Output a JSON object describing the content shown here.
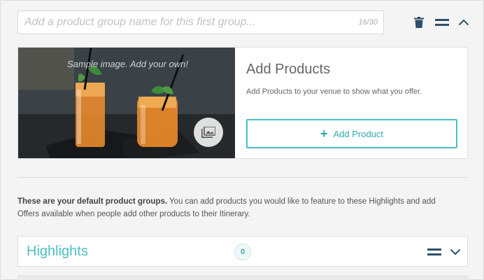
{
  "group": {
    "name_placeholder": "Add a product group name for this first group...",
    "name_value": "",
    "char_count": "16/30"
  },
  "icons": {
    "trash": "trash-icon",
    "drag": "drag-handle-icon",
    "collapse": "chevron-up-icon",
    "image_upload": "image-gallery-icon",
    "plus": "plus-icon",
    "expand": "chevron-down-icon"
  },
  "product_card": {
    "sample_caption": "Sample image. Add your own!",
    "title": "Add Products",
    "description": "Add Products to your venue to show what you offer.",
    "button_label": "Add Product",
    "button_plus": "+"
  },
  "info": {
    "bold": "These are your default product groups.",
    "text": " You can add products you would like to feature to these Highlights and add Offers available when people add other products to their Itinerary."
  },
  "highlights": {
    "title": "Highlights",
    "count": "0"
  },
  "colors": {
    "accent": "#4bbfc4",
    "icon": "#2f4f68",
    "text": "#555555",
    "background": "#f4f4f4"
  }
}
